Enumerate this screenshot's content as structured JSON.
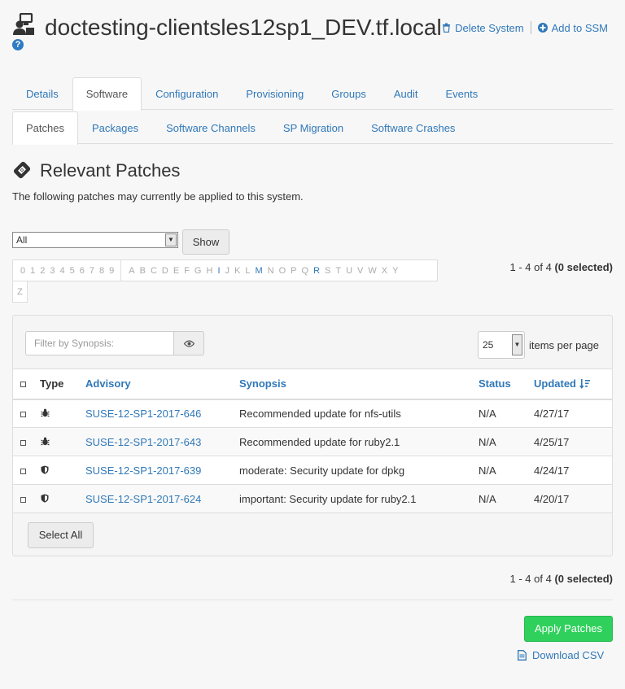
{
  "header": {
    "system_name": "doctesting-clientsles12sp1_DEV.tf.local",
    "help_glyph": "?",
    "delete_label": "Delete System",
    "ssm_label": "Add to SSM"
  },
  "tabs_primary": [
    {
      "label": "Details",
      "active": false
    },
    {
      "label": "Software",
      "active": true
    },
    {
      "label": "Configuration",
      "active": false
    },
    {
      "label": "Provisioning",
      "active": false
    },
    {
      "label": "Groups",
      "active": false
    },
    {
      "label": "Audit",
      "active": false
    },
    {
      "label": "Events",
      "active": false
    }
  ],
  "tabs_secondary": [
    {
      "label": "Patches",
      "active": true
    },
    {
      "label": "Packages",
      "active": false
    },
    {
      "label": "Software Channels",
      "active": false
    },
    {
      "label": "SP Migration",
      "active": false
    },
    {
      "label": "Software Crashes",
      "active": false
    }
  ],
  "section": {
    "title": "Relevant Patches",
    "description": "The following patches may currently be applied to this system."
  },
  "filter": {
    "selected": "All",
    "show_label": "Show"
  },
  "alphabar": {
    "digits": [
      "0",
      "1",
      "2",
      "3",
      "4",
      "5",
      "6",
      "7",
      "8",
      "9"
    ],
    "letters": [
      "A",
      "B",
      "C",
      "D",
      "E",
      "F",
      "G",
      "H",
      "I",
      "J",
      "K",
      "L",
      "M",
      "N",
      "O",
      "P",
      "Q",
      "R",
      "S",
      "T",
      "U",
      "V",
      "W",
      "X",
      "Y"
    ],
    "active_letters": [
      "I",
      "M",
      "R"
    ],
    "overflow": "Z"
  },
  "count": {
    "range": "1 - 4 of 4",
    "selected": "(0 selected)"
  },
  "table": {
    "filter_placeholder": "Filter by Synopsis:",
    "per_page_value": "25",
    "per_page_label": "items per page",
    "columns": {
      "type": "Type",
      "advisory": "Advisory",
      "synopsis": "Synopsis",
      "status": "Status",
      "updated": "Updated"
    },
    "rows": [
      {
        "type_icon": "bug-icon",
        "advisory": "SUSE-12-SP1-2017-646",
        "synopsis": "Recommended update for nfs-utils",
        "status": "N/A",
        "updated": "4/27/17"
      },
      {
        "type_icon": "bug-icon",
        "advisory": "SUSE-12-SP1-2017-643",
        "synopsis": "Recommended update for ruby2.1",
        "status": "N/A",
        "updated": "4/25/17"
      },
      {
        "type_icon": "shield-icon",
        "advisory": "SUSE-12-SP1-2017-639",
        "synopsis": "moderate: Security update for dpkg",
        "status": "N/A",
        "updated": "4/24/17"
      },
      {
        "type_icon": "shield-icon",
        "advisory": "SUSE-12-SP1-2017-624",
        "synopsis": "important: Security update for ruby2.1",
        "status": "N/A",
        "updated": "4/20/17"
      }
    ],
    "select_all_label": "Select All"
  },
  "footer": {
    "apply_label": "Apply Patches",
    "csv_label": "Download CSV"
  },
  "colors": {
    "link": "#3078b8",
    "apply": "#30d05c"
  }
}
